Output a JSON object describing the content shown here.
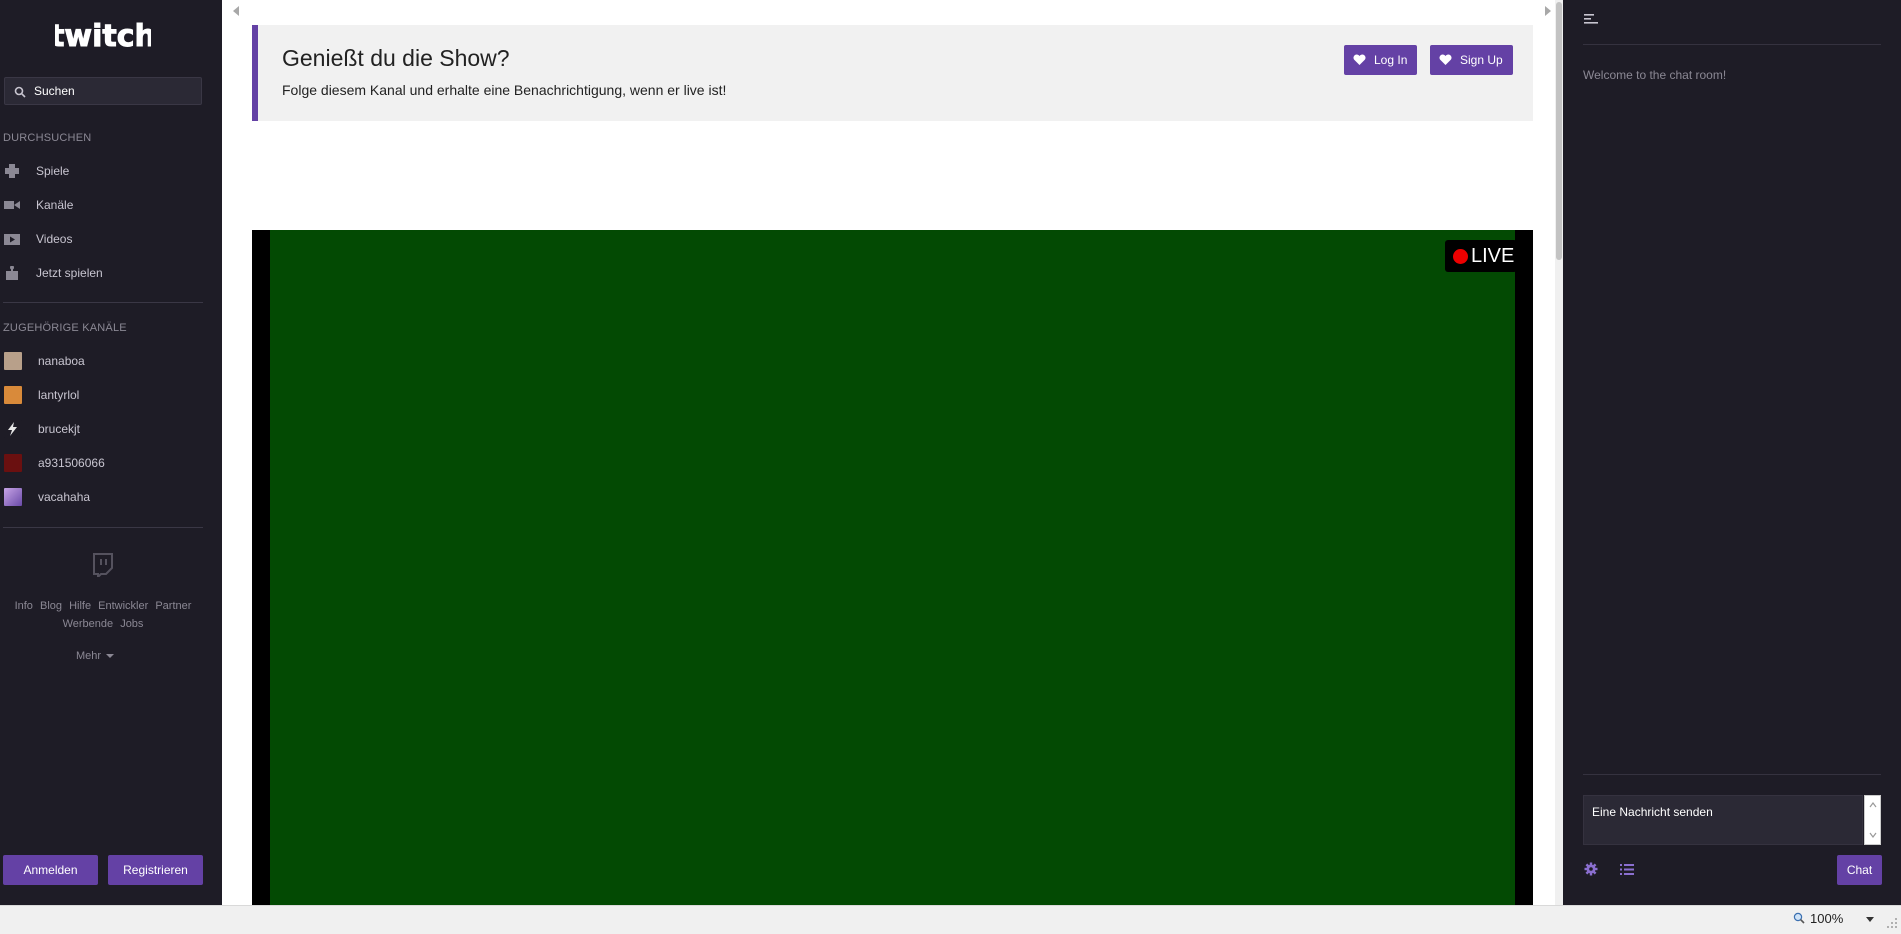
{
  "sidebar": {
    "logo": "twitch",
    "search_placeholder": "Suchen",
    "browse_title": "DURCHSUCHEN",
    "browse_items": [
      {
        "label": "Spiele",
        "icon": "gamepad-icon"
      },
      {
        "label": "Kanäle",
        "icon": "video-camera-icon"
      },
      {
        "label": "Videos",
        "icon": "play-icon"
      },
      {
        "label": "Jetzt spielen",
        "icon": "joystick-icon"
      }
    ],
    "related_title": "ZUGEHÖRIGE KANÄLE",
    "channels": [
      {
        "name": "nanaboa"
      },
      {
        "name": "lantyrlol"
      },
      {
        "name": "brucekjt"
      },
      {
        "name": "a931506066"
      },
      {
        "name": "vacahaha"
      }
    ],
    "footer_links": [
      "Info",
      "Blog",
      "Hilfe",
      "Entwickler",
      "Partner",
      "Werbende",
      "Jobs"
    ],
    "more_label": "Mehr",
    "login_label": "Anmelden",
    "register_label": "Registrieren"
  },
  "promo": {
    "title": "Genießt du die Show?",
    "subtitle": "Folge diesem Kanal und erhalte eine Benachrichtigung, wenn er live ist!",
    "login_label": "Log In",
    "signup_label": "Sign Up"
  },
  "player": {
    "live_label": "LIVE"
  },
  "chat": {
    "welcome": "Welcome to the chat room!",
    "input_placeholder": "Eine Nachricht senden",
    "send_label": "Chat"
  },
  "statusbar": {
    "zoom": "100%"
  },
  "colors": {
    "accent": "#6441a5",
    "sidebar_bg": "#1e1c26",
    "video_bg": "#034a03",
    "live_dot": "#ee0000"
  }
}
